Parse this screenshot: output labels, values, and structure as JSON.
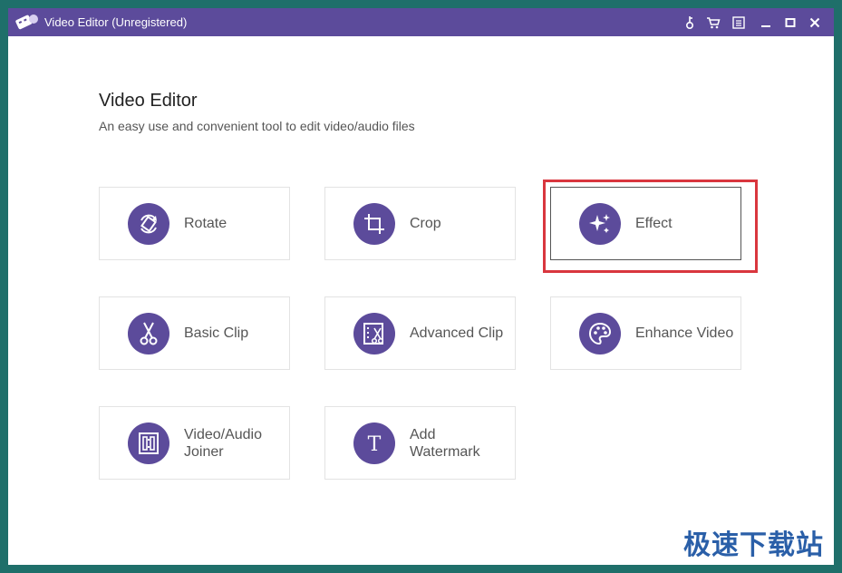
{
  "window": {
    "title": "Video Editor (Unregistered)"
  },
  "titlebar_buttons": [
    "key-icon",
    "cart-icon",
    "menu-icon",
    "minimize-icon",
    "maximize-icon",
    "close-icon"
  ],
  "header": {
    "title": "Video Editor",
    "subtitle": "An easy use and convenient tool to edit video/audio files"
  },
  "tools": [
    {
      "label": "Rotate",
      "icon": "rotate-icon"
    },
    {
      "label": "Crop",
      "icon": "crop-icon"
    },
    {
      "label": "Effect",
      "icon": "sparkle-icon",
      "selected": true
    },
    {
      "label": "Basic Clip",
      "icon": "scissors-icon"
    },
    {
      "label": "Advanced Clip",
      "icon": "advanced-clip-icon"
    },
    {
      "label": "Enhance Video",
      "icon": "palette-icon"
    },
    {
      "label": "Video/Audio Joiner",
      "icon": "joiner-icon"
    },
    {
      "label": "Add Watermark",
      "icon": "text-t-icon"
    }
  ],
  "colors": {
    "accent": "#5c4b9b",
    "highlight": "#d9363e"
  },
  "watermark_text": "极速下载站"
}
